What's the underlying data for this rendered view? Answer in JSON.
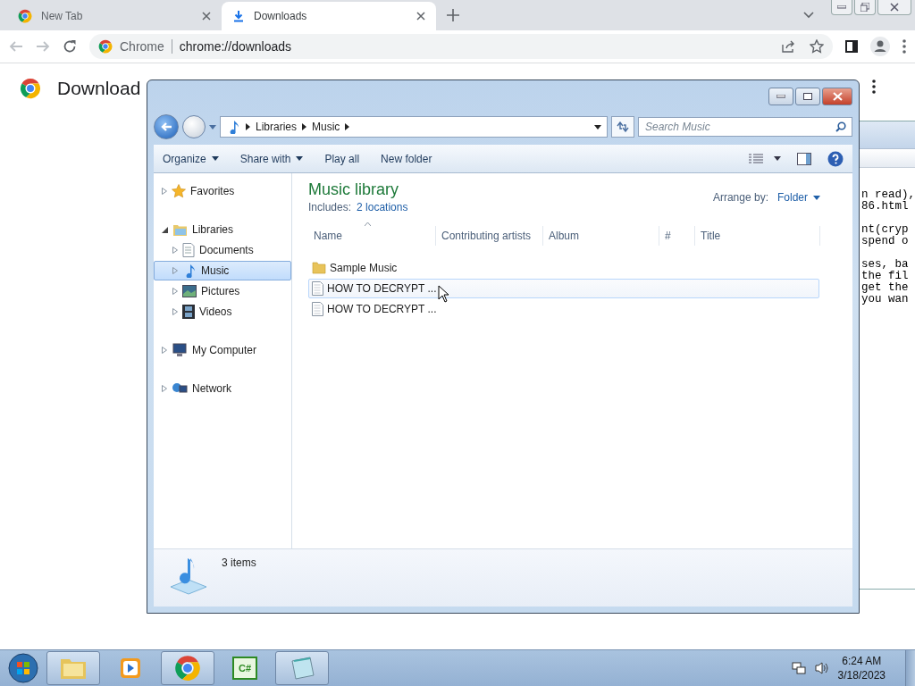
{
  "browser": {
    "tabs": [
      {
        "title": "New Tab",
        "kind": "newtab",
        "selected": false
      },
      {
        "title": "Downloads",
        "kind": "downloads",
        "selected": true
      }
    ],
    "omnibox": {
      "site": "Chrome",
      "url": "chrome://downloads"
    },
    "page_title": "Download"
  },
  "background_window": {
    "paragraphs": [
      [
        "n read),",
        "86.html"
      ],
      [
        "nt(cryp",
        "spend o"
      ],
      [
        "ses, ba",
        "the fil",
        "get the",
        "you wan"
      ]
    ]
  },
  "explorer": {
    "breadcrumb": [
      "Libraries",
      "Music"
    ],
    "search": {
      "placeholder": "Search Music"
    },
    "commands": [
      {
        "label": "Organize",
        "dropdown": true
      },
      {
        "label": "Share with",
        "dropdown": true
      },
      {
        "label": "Play all",
        "dropdown": false
      },
      {
        "label": "New folder",
        "dropdown": false
      }
    ],
    "nav_groups": [
      [
        {
          "label": "Favorites",
          "kind": "star",
          "expanded": false,
          "selected": false
        }
      ],
      [
        {
          "label": "Libraries",
          "kind": "library",
          "expanded": true,
          "selected": false,
          "children": [
            {
              "label": "Documents",
              "kind": "document",
              "expanded": false,
              "selected": false
            },
            {
              "label": "Music",
              "kind": "music",
              "expanded": false,
              "selected": true
            },
            {
              "label": "Pictures",
              "kind": "picture",
              "expanded": false,
              "selected": false
            },
            {
              "label": "Videos",
              "kind": "video",
              "expanded": false,
              "selected": false
            }
          ]
        }
      ],
      [
        {
          "label": "My Computer",
          "kind": "computer",
          "expanded": false,
          "selected": false
        }
      ],
      [
        {
          "label": "Network",
          "kind": "network",
          "expanded": false,
          "selected": false
        }
      ]
    ],
    "library": {
      "title": "Music library",
      "includes_label": "Includes:",
      "includes_link": "2 locations",
      "arrange_label": "Arrange by:",
      "arrange_value": "Folder"
    },
    "columns": [
      "Name",
      "Contributing artists",
      "Album",
      "#",
      "Title"
    ],
    "files": [
      {
        "name": "Sample Music",
        "kind": "folder",
        "hovered": false
      },
      {
        "name": "HOW TO DECRYPT ...",
        "kind": "document",
        "hovered": true
      },
      {
        "name": "HOW TO DECRYPT ...",
        "kind": "document",
        "hovered": false
      }
    ],
    "status": "3 items"
  },
  "taskbar": {
    "apps": [
      {
        "kind": "explorer",
        "running": true
      },
      {
        "kind": "media",
        "running": false
      },
      {
        "kind": "chrome",
        "running": true
      },
      {
        "kind": "csharp",
        "label": "C#",
        "running": false
      },
      {
        "kind": "notepad",
        "running": true
      }
    ],
    "time": "6:24 AM",
    "date": "3/18/2023"
  }
}
